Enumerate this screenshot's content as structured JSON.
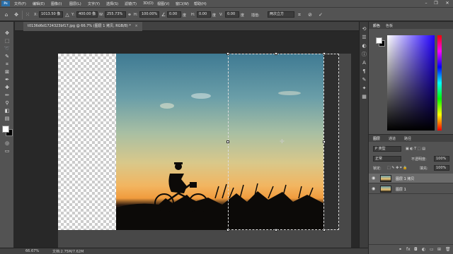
{
  "menubar": {
    "logo": "Ps",
    "items": [
      "文件(F)",
      "编辑(E)",
      "图像(I)",
      "图层(L)",
      "文字(Y)",
      "选择(S)",
      "滤镜(T)",
      "3D(D)",
      "视图(V)",
      "窗口(W)",
      "帮助(H)"
    ],
    "minimize": "–",
    "maximize": "❐",
    "close": "✕"
  },
  "options": {
    "x_label": "X:",
    "x_value": "1013.50 像",
    "y_label": "Y:",
    "y_value": "400.00 像",
    "w_label": "W:",
    "w_value": "255.73%",
    "h_label": "H:",
    "h_value": "100.00%",
    "angle_value": "0.00",
    "hskew_label": "H:",
    "hskew_value": "0.00",
    "vskew_label": "V:",
    "vskew_value": "0.00",
    "interp_label": "插值:",
    "interp_value": "两次立方",
    "cancel_icon": "⊘",
    "commit_icon": "✓"
  },
  "document": {
    "tab_title": "t0136d6d1724323bf17.jpg @ 66.7% (图层 1 拷贝, RGB/8) *",
    "tab_close": "×"
  },
  "status": {
    "zoom": "66.67%",
    "doc_size": "文档:2.75M/7.62M"
  },
  "color_panel": {
    "tabs": [
      "颜色",
      "色板"
    ]
  },
  "layers_panel": {
    "tabs": [
      "图层",
      "通道",
      "路径"
    ],
    "filter_placeholder": "P 类型",
    "blend_mode": "正常",
    "opacity_label": "不透明度:",
    "opacity_value": "100%",
    "lock_label": "锁定:",
    "fill_label": "填充:",
    "fill_value": "100%",
    "layers": [
      {
        "name": "图层 1 拷贝",
        "selected": true
      },
      {
        "name": "图层 1",
        "selected": false
      }
    ]
  },
  "colors": {
    "panel_bg": "#535353",
    "workspace_bg": "#282828",
    "selection_dash": "#dcdcdc",
    "ps_blue": "#2b6fa8"
  }
}
